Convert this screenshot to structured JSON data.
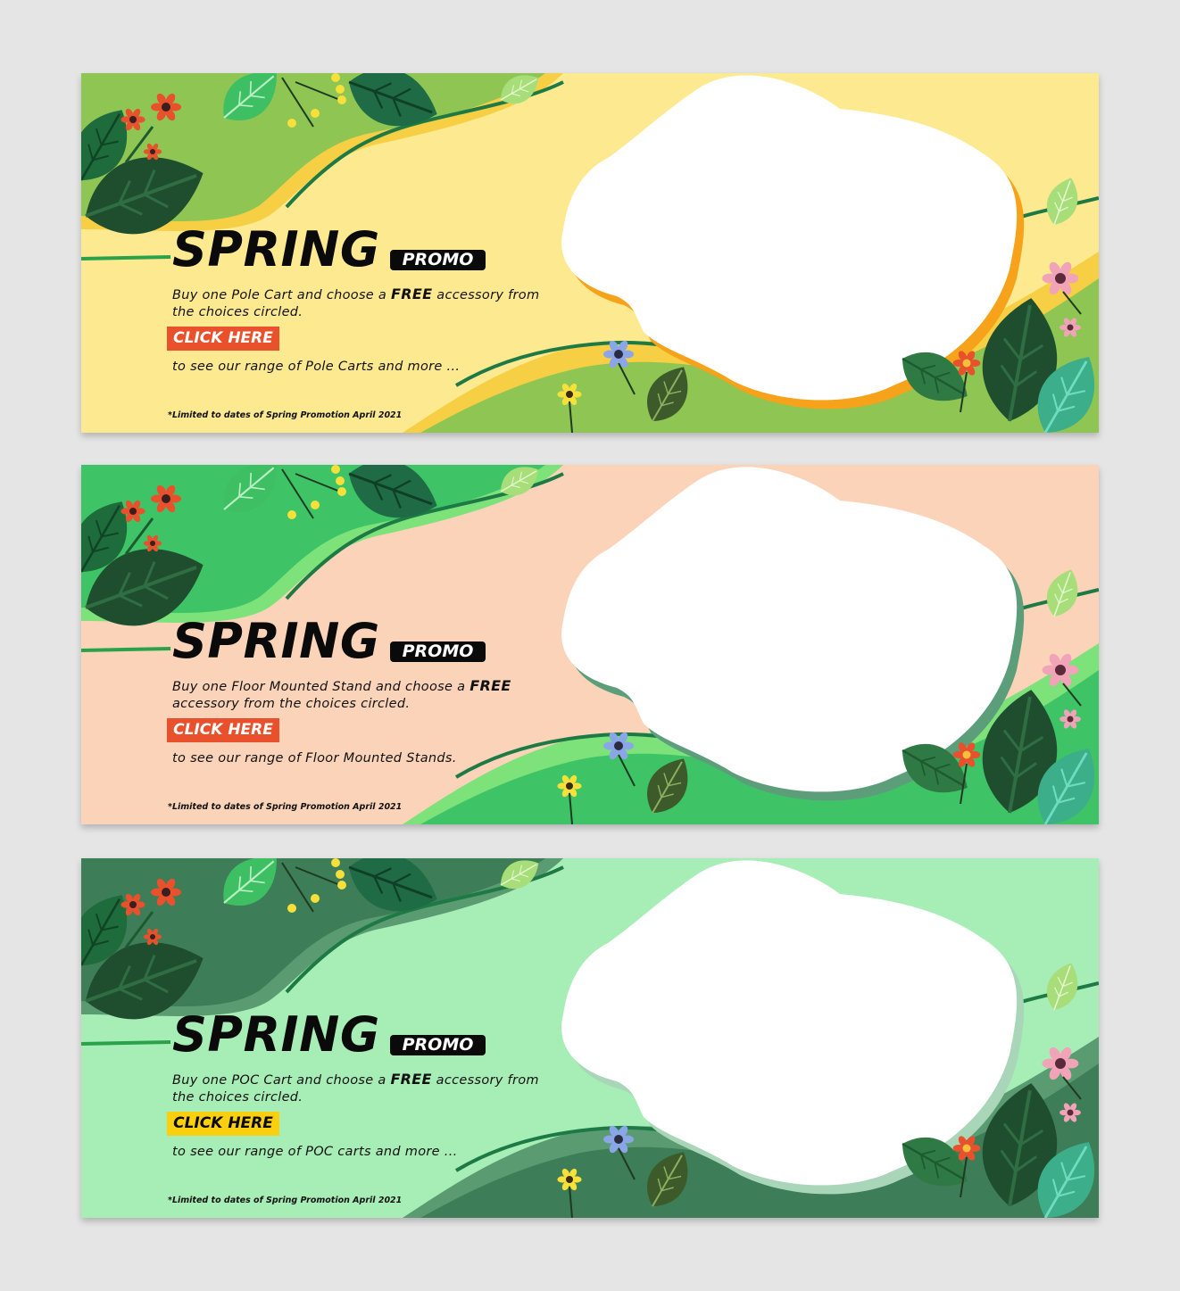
{
  "banners": [
    {
      "title": "SPRING",
      "promo": "PROMO",
      "desc_before": "Buy one Pole Cart and choose a ",
      "desc_free": "FREE",
      "desc_after": " accessory from the choices circled.",
      "cta": "CLICK HERE",
      "range": "to see our range of Pole Carts and more ...",
      "disclaimer": "*Limited to dates of Spring Promotion April 2021",
      "colors": {
        "bg": "#fde98f",
        "main": "#8ec553",
        "accent": "#f6cf44",
        "blobShadow": "#f6a21a",
        "ctaBg": "#e8512b",
        "ctaText": "#ffffff"
      }
    },
    {
      "title": "SPRING",
      "promo": "PROMO",
      "desc_before": "Buy one Floor Mounted Stand and choose a ",
      "desc_free": "FREE",
      "desc_after": " accessory from the choices circled.",
      "cta": "CLICK HERE",
      "range": "to see our range of Floor Mounted Stands.",
      "disclaimer": "*Limited to dates of Spring Promotion April 2021",
      "colors": {
        "bg": "#fbd3b8",
        "main": "#3ec466",
        "accent": "#7de27a",
        "blobShadow": "#5c9e7a",
        "ctaBg": "#e8512b",
        "ctaText": "#ffffff"
      }
    },
    {
      "title": "SPRING",
      "promo": "PROMO",
      "desc_before": "Buy one POC Cart and choose a ",
      "desc_free": "FREE",
      "desc_after": " accessory from the choices circled.",
      "cta": "CLICK HERE",
      "range": "to see our range of POC carts and more ...",
      "disclaimer": "*Limited to dates of Spring Promotion April 2021",
      "colors": {
        "bg": "#a6edb6",
        "main": "#3d7d57",
        "accent": "#5a9b71",
        "blobShadow": "#a9d6b8",
        "ctaBg": "#f9cf10",
        "ctaText": "#0a0a0a"
      }
    }
  ]
}
